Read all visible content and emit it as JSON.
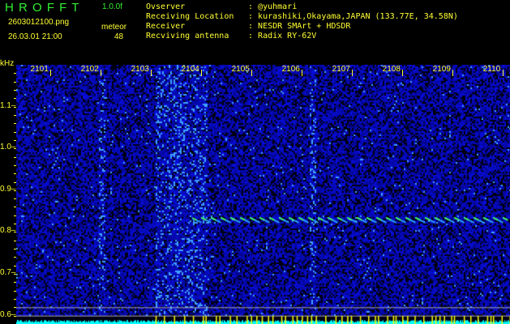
{
  "header": {
    "brand": "H R O F F T",
    "version": "1.0.0f",
    "filename": "2603012100.png",
    "datetime": "26.03.01 21:00",
    "meteor_label": "meteor",
    "meteor_count": "48",
    "info": [
      {
        "label": "Ovserver",
        "value": "@yuhmari"
      },
      {
        "label": "Receiving Location",
        "value": "kurashiki,Okayama,JAPAN (133.77E, 34.58N)"
      },
      {
        "label": "Receiver",
        "value": "NESDR SMArt + HDSDR"
      },
      {
        "label": "Recviving antenna",
        "value": "Radix RY-62V"
      }
    ]
  },
  "chart_data": {
    "type": "heatmap",
    "title": "HROFFT spectrogram",
    "ylabel": "kHz",
    "y_ticks": [
      "1.1",
      "1.0",
      "0.9",
      "0.8",
      "0.7",
      "0.6"
    ],
    "ylim": [
      0.58,
      1.2
    ],
    "x_ticks": [
      "2101",
      "2102",
      "2103",
      "2104",
      "2105",
      "2106",
      "2107",
      "2108",
      "2109",
      "2110"
    ],
    "xlim": [
      2100.33,
      2110.15
    ],
    "echo": {
      "start": 2103.83,
      "end": 2110.1,
      "freq_khz": 0.83
    },
    "reference_lines_khz": [
      0.62,
      0.6,
      0.58
    ],
    "colors": {
      "noise": "#1a22c8",
      "echo": "#44ff66",
      "spectrum": "#00ffff",
      "marker": "#ffff00"
    }
  }
}
